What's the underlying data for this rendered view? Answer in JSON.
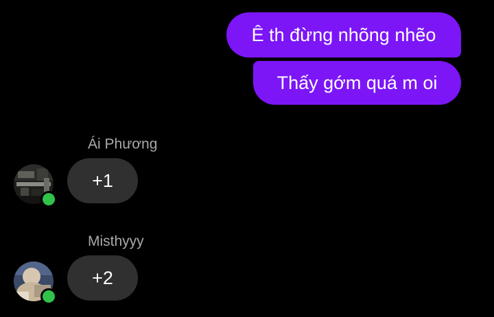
{
  "thread": {
    "outgoing": [
      {
        "text": "Ê th đừng nhõng nhẽo"
      },
      {
        "text": "Thấy gớm quá m oi"
      }
    ],
    "incoming": [
      {
        "sender": "Ái Phương",
        "text": "+1",
        "avatar_icon": "user-avatar-icon",
        "online": true
      },
      {
        "sender": "Misthyyy",
        "text": "+2",
        "avatar_icon": "user-avatar-icon",
        "online": true
      }
    ]
  },
  "colors": {
    "background": "#000000",
    "outgoing_bubble": "#7c16f7",
    "incoming_bubble": "#303030",
    "sender_name": "#a9a9a9",
    "presence_online": "#31c24a"
  }
}
